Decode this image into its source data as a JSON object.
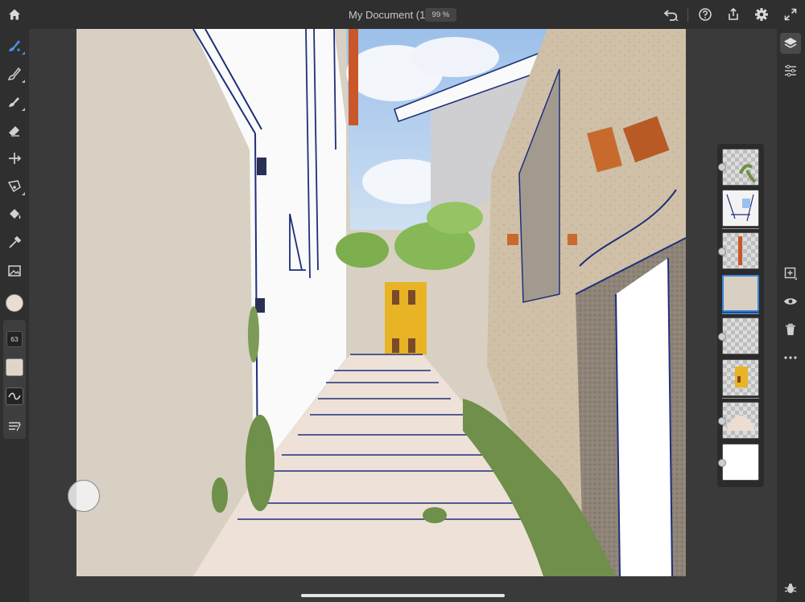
{
  "header": {
    "document_title": "My Document (1)",
    "zoom": "99 %",
    "icons": [
      "home-icon",
      "undo-icon",
      "help-icon",
      "share-icon",
      "settings-icon",
      "fullscreen-icon"
    ]
  },
  "left_toolbar": {
    "tools": [
      "paint-brush-tool",
      "pixel-brush-tool",
      "fill-brush-tool",
      "eraser-tool",
      "transform-tool",
      "selection-tool",
      "fill-tool",
      "eyedropper-tool",
      "image-tool"
    ],
    "brush_size": "63",
    "current_color": "#e8dfd2"
  },
  "right_toolbar": {
    "icons": [
      "layers-icon",
      "properties-icon",
      "add-layer-icon",
      "visibility-icon",
      "delete-icon",
      "more-icon",
      "bug-icon"
    ]
  },
  "layers": {
    "count": 8,
    "selected_index": 3,
    "items": [
      {
        "thumb": "plants"
      },
      {
        "thumb": "sketch"
      },
      {
        "thumb": "orange-stroke"
      },
      {
        "thumb": "beige-fill"
      },
      {
        "thumb": "transparent"
      },
      {
        "thumb": "yellow-house"
      },
      {
        "thumb": "pink-shape"
      },
      {
        "thumb": "white-background"
      }
    ]
  },
  "colors": {
    "toolbar_bg": "#2f2f2f",
    "workspace_bg": "#3a3a3a",
    "accent": "#3b82d8",
    "wall_beige": "#d8d0c2",
    "sky_blue": "#a9c8ec",
    "house_yellow": "#e8b325"
  }
}
